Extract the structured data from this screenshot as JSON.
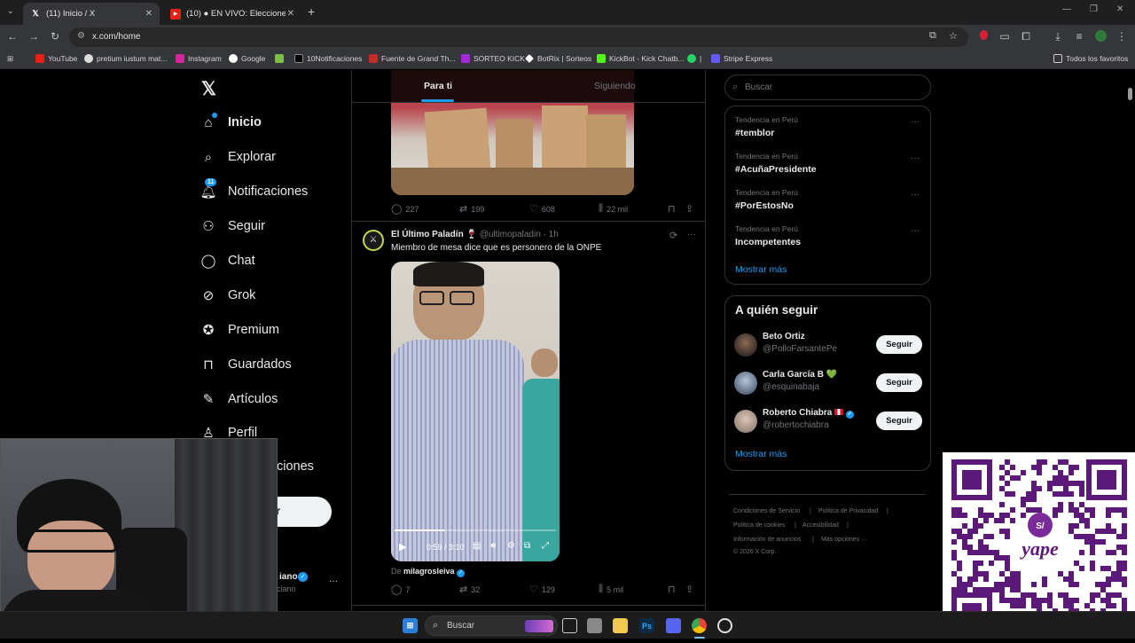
{
  "browser": {
    "tabs": [
      {
        "label": "(11) Inicio / X",
        "active": true
      },
      {
        "label": "(10) ● EN VIVO: Elecciones Ge",
        "active": false
      }
    ],
    "url": "x.com/home",
    "bookmarks": [
      "YouTube",
      "pretium iustum mat...",
      "Instagram",
      "Google",
      "10Notificaciones",
      "Fuente de Grand Th...",
      "SORTEO KICK",
      "BotRix | Sorteos",
      "KickBot - Kick Chatb...",
      "|",
      "Stripe Express"
    ],
    "all_bookmarks": "Todos los favoritos"
  },
  "sidebar": {
    "items": [
      {
        "label": "Inicio",
        "icon": "home-icon",
        "badge": ""
      },
      {
        "label": "Explorar",
        "icon": "search-icon",
        "badge": ""
      },
      {
        "label": "Notificaciones",
        "icon": "bell-icon",
        "badge": "11"
      },
      {
        "label": "Seguir",
        "icon": "add-user-icon",
        "badge": ""
      },
      {
        "label": "Chat",
        "icon": "chat-icon",
        "badge": ""
      },
      {
        "label": "Grok",
        "icon": "grok-icon",
        "badge": ""
      },
      {
        "label": "Premium",
        "icon": "verified-icon",
        "badge": ""
      },
      {
        "label": "Guardados",
        "icon": "bookmark-icon",
        "badge": ""
      },
      {
        "label": "Artículos",
        "icon": "article-icon",
        "badge": ""
      },
      {
        "label": "Perfil",
        "icon": "user-icon",
        "badge": ""
      },
      {
        "label": "ciones",
        "icon": "",
        "badge": ""
      }
    ],
    "post_button_fragment": "r",
    "account_name_fragment": "iano",
    "account_handle_fragment": "ciano",
    "more": "···"
  },
  "feed": {
    "tabs": [
      "Para ti",
      "Siguiendo"
    ],
    "post1_stats": {
      "replies": "227",
      "reposts": "199",
      "likes": "608",
      "views": "22 mil"
    },
    "post2": {
      "author": "El Último Paladín",
      "handle": "@ultimopaladin",
      "time": "· 1h",
      "text": "Miembro de mesa dice que es personero de la ONPE",
      "video_time": "0:59 / 3:10",
      "from_label": "De",
      "from_user": "milagrosleiva",
      "stats": {
        "replies": "7",
        "reposts": "32",
        "likes": "129",
        "views": "5 mil"
      }
    }
  },
  "right": {
    "search_placeholder": "Buscar",
    "trends": [
      {
        "category": "Tendencia en Perú",
        "name": "#temblor"
      },
      {
        "category": "Tendencia en Perú",
        "name": "#AcuñaPresidente"
      },
      {
        "category": "Tendencia en Perú",
        "name": "#PorEstosNo"
      },
      {
        "category": "Tendencia en Perú",
        "name": "Incompetentes"
      }
    ],
    "show_more": "Mostrar más",
    "who_to_follow_title": "A quién seguir",
    "follow": [
      {
        "name": "Beto Ortiz",
        "handle": "@PolloFarsantePe",
        "button": "Seguir"
      },
      {
        "name": "Carla García B 💚",
        "handle": "@esquinabaja",
        "button": "Seguir"
      },
      {
        "name": "Roberto Chiabra",
        "handle": "@robertochiabra",
        "button": "Seguir"
      }
    ],
    "show_more_2": "Mostrar más",
    "footer": [
      "Condiciones de Servicio",
      "Política de Privacidad",
      "Política de cookies",
      "Accesibilidad",
      "Información de anuncios",
      "Más opciones ···",
      "© 2026 X Corp."
    ]
  },
  "taskbar": {
    "search": "Buscar"
  },
  "overlay": {
    "qr_brand": "yape",
    "qr_symbol": "S/"
  }
}
